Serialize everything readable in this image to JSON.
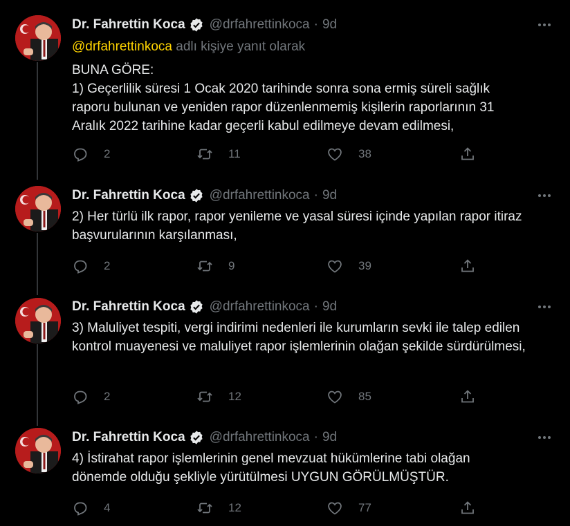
{
  "author": {
    "name": "Dr. Fahrettin Koca",
    "handle": "@drfahrettinkoca",
    "dot": "·",
    "time": "9d"
  },
  "reply_to": {
    "mention": "@drfahrettinkoca",
    "suffix": "adlı kişiye yanıt olarak"
  },
  "tweets": [
    {
      "lines": [
        "BUNA GÖRE:",
        "1) Geçerlilik süresi 1 Ocak 2020 tarihinde sonra sona ermiş süreli sağlık raporu bulunan ve yeniden rapor düzenlenmemiş kişilerin raporlarının 31 Aralık 2022 tarihine kadar geçerli kabul edilmeye devam edilmesi,"
      ],
      "replies": "2",
      "retweets": "11",
      "likes": "38"
    },
    {
      "lines": [
        "2) Her türlü ilk rapor, rapor yenileme ve yasal süresi içinde yapılan rapor itiraz başvurularının karşılanması,"
      ],
      "replies": "2",
      "retweets": "9",
      "likes": "39"
    },
    {
      "lines": [
        "3) Maluliyet tespiti, vergi indirimi nedenleri ile kurumların sevki ile talep edilen kontrol muayenesi ve maluliyet rapor işlemlerinin olağan şekilde sürdürülmesi,"
      ],
      "replies": "2",
      "retweets": "12",
      "likes": "85"
    },
    {
      "lines": [
        "4) İstirahat rapor işlemlerinin genel mevzuat hükümlerine tabi olağan dönemde olduğu şekliyle yürütülmesi UYGUN GÖRÜLMÜŞTÜR."
      ],
      "replies": "4",
      "retweets": "12",
      "likes": "77"
    }
  ],
  "icons": {
    "reply": "reply-icon",
    "retweet": "retweet-icon",
    "like": "heart-icon",
    "share": "share-icon",
    "more": "more-icon",
    "verified": "verified-badge-icon"
  },
  "colors": {
    "background": "#000000",
    "text": "#e7e9ea",
    "muted": "#71767b",
    "mention": "#ffd400",
    "thread_line": "#333639"
  }
}
